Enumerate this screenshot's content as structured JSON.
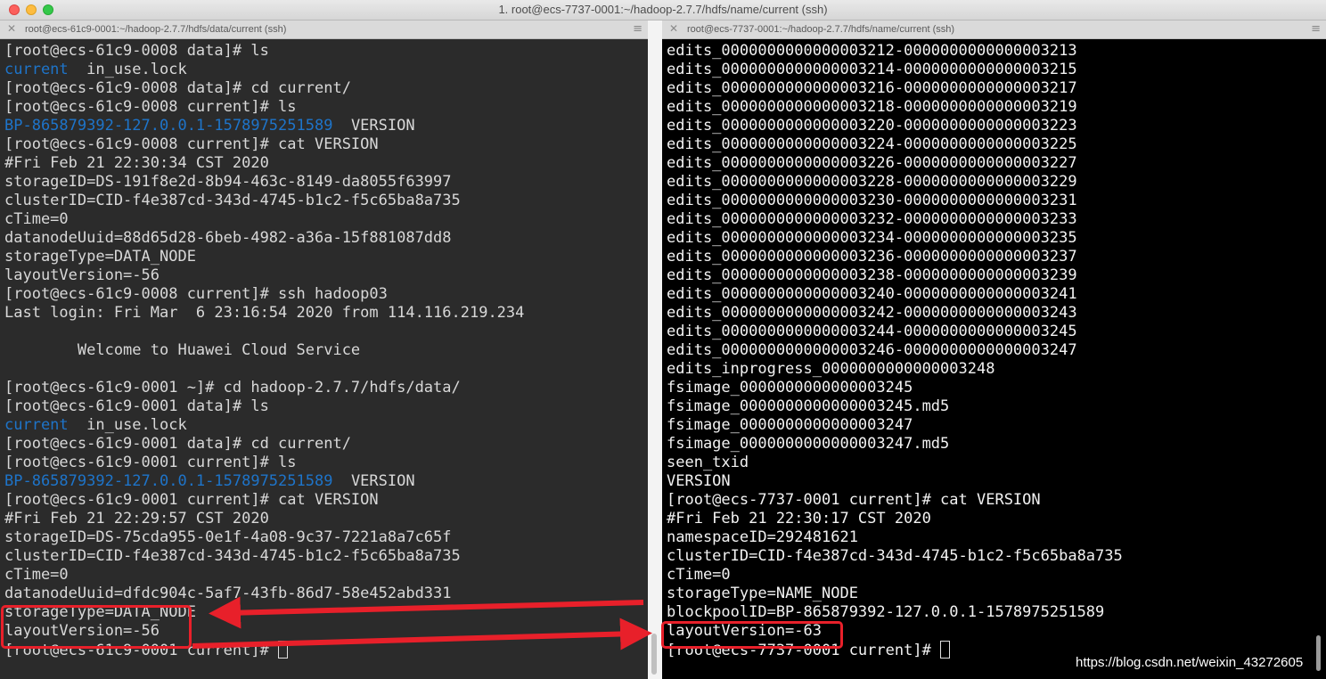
{
  "window": {
    "title": "1. root@ecs-7737-0001:~/hadoop-2.7.7/hdfs/name/current (ssh)"
  },
  "left_pane": {
    "tab_title": "root@ecs-61c9-0001:~/hadoop-2.7.7/hdfs/data/current (ssh)",
    "lines": [
      [
        {
          "t": "[root@ecs-61c9-0008 data]# ls"
        }
      ],
      [
        {
          "t": "current",
          "c": "blue"
        },
        {
          "t": "  in_use.lock"
        }
      ],
      [
        {
          "t": "[root@ecs-61c9-0008 data]# cd current/"
        }
      ],
      [
        {
          "t": "[root@ecs-61c9-0008 current]# ls"
        }
      ],
      [
        {
          "t": "BP-865879392-127.0.0.1-1578975251589",
          "c": "blue"
        },
        {
          "t": "  VERSION"
        }
      ],
      [
        {
          "t": "[root@ecs-61c9-0008 current]# cat VERSION"
        }
      ],
      [
        {
          "t": "#Fri Feb 21 22:30:34 CST 2020"
        }
      ],
      [
        {
          "t": "storageID=DS-191f8e2d-8b94-463c-8149-da8055f63997"
        }
      ],
      [
        {
          "t": "clusterID=CID-f4e387cd-343d-4745-b1c2-f5c65ba8a735"
        }
      ],
      [
        {
          "t": "cTime=0"
        }
      ],
      [
        {
          "t": "datanodeUuid=88d65d28-6beb-4982-a36a-15f881087dd8"
        }
      ],
      [
        {
          "t": "storageType=DATA_NODE"
        }
      ],
      [
        {
          "t": "layoutVersion=-56"
        }
      ],
      [
        {
          "t": "[root@ecs-61c9-0008 current]# ssh hadoop03"
        }
      ],
      [
        {
          "t": "Last login: Fri Mar  6 23:16:54 2020 from 114.116.219.234"
        }
      ],
      [
        {
          "t": ""
        }
      ],
      [
        {
          "t": "        Welcome to Huawei Cloud Service"
        }
      ],
      [
        {
          "t": ""
        }
      ],
      [
        {
          "t": "[root@ecs-61c9-0001 ~]# cd hadoop-2.7.7/hdfs/data/"
        }
      ],
      [
        {
          "t": "[root@ecs-61c9-0001 data]# ls"
        }
      ],
      [
        {
          "t": "current",
          "c": "blue"
        },
        {
          "t": "  in_use.lock"
        }
      ],
      [
        {
          "t": "[root@ecs-61c9-0001 data]# cd current/"
        }
      ],
      [
        {
          "t": "[root@ecs-61c9-0001 current]# ls"
        }
      ],
      [
        {
          "t": "BP-865879392-127.0.0.1-1578975251589",
          "c": "blue"
        },
        {
          "t": "  VERSION"
        }
      ],
      [
        {
          "t": "[root@ecs-61c9-0001 current]# cat VERSION"
        }
      ],
      [
        {
          "t": "#Fri Feb 21 22:29:57 CST 2020"
        }
      ],
      [
        {
          "t": "storageID=DS-75cda955-0e1f-4a08-9c37-7221a8a7c65f"
        }
      ],
      [
        {
          "t": "clusterID=CID-f4e387cd-343d-4745-b1c2-f5c65ba8a735"
        }
      ],
      [
        {
          "t": "cTime=0"
        }
      ],
      [
        {
          "t": "datanodeUuid=dfdc904c-5af7-43fb-86d7-58e452abd331"
        }
      ],
      [
        {
          "t": "storageType=DATA_NODE"
        }
      ],
      [
        {
          "t": "layoutVersion=-56"
        }
      ],
      [
        {
          "t": "[root@ecs-61c9-0001 current]# "
        },
        {
          "cursor": true
        }
      ]
    ]
  },
  "right_pane": {
    "tab_title": "root@ecs-7737-0001:~/hadoop-2.7.7/hdfs/name/current (ssh)",
    "lines": [
      [
        {
          "t": "edits_0000000000000003212-0000000000000003213"
        }
      ],
      [
        {
          "t": "edits_0000000000000003214-0000000000000003215"
        }
      ],
      [
        {
          "t": "edits_0000000000000003216-0000000000000003217"
        }
      ],
      [
        {
          "t": "edits_0000000000000003218-0000000000000003219"
        }
      ],
      [
        {
          "t": "edits_0000000000000003220-0000000000000003223"
        }
      ],
      [
        {
          "t": "edits_0000000000000003224-0000000000000003225"
        }
      ],
      [
        {
          "t": "edits_0000000000000003226-0000000000000003227"
        }
      ],
      [
        {
          "t": "edits_0000000000000003228-0000000000000003229"
        }
      ],
      [
        {
          "t": "edits_0000000000000003230-0000000000000003231"
        }
      ],
      [
        {
          "t": "edits_0000000000000003232-0000000000000003233"
        }
      ],
      [
        {
          "t": "edits_0000000000000003234-0000000000000003235"
        }
      ],
      [
        {
          "t": "edits_0000000000000003236-0000000000000003237"
        }
      ],
      [
        {
          "t": "edits_0000000000000003238-0000000000000003239"
        }
      ],
      [
        {
          "t": "edits_0000000000000003240-0000000000000003241"
        }
      ],
      [
        {
          "t": "edits_0000000000000003242-0000000000000003243"
        }
      ],
      [
        {
          "t": "edits_0000000000000003244-0000000000000003245"
        }
      ],
      [
        {
          "t": "edits_0000000000000003246-0000000000000003247"
        }
      ],
      [
        {
          "t": "edits_inprogress_0000000000000003248"
        }
      ],
      [
        {
          "t": "fsimage_0000000000000003245"
        }
      ],
      [
        {
          "t": "fsimage_0000000000000003245.md5"
        }
      ],
      [
        {
          "t": "fsimage_0000000000000003247"
        }
      ],
      [
        {
          "t": "fsimage_0000000000000003247.md5"
        }
      ],
      [
        {
          "t": "seen_txid"
        }
      ],
      [
        {
          "t": "VERSION"
        }
      ],
      [
        {
          "t": "[root@ecs-7737-0001 current]# cat VERSION"
        }
      ],
      [
        {
          "t": "#Fri Feb 21 22:30:17 CST 2020"
        }
      ],
      [
        {
          "t": "namespaceID=292481621"
        }
      ],
      [
        {
          "t": "clusterID=CID-f4e387cd-343d-4745-b1c2-f5c65ba8a735"
        }
      ],
      [
        {
          "t": "cTime=0"
        }
      ],
      [
        {
          "t": "storageType=NAME_NODE"
        }
      ],
      [
        {
          "t": "blockpoolID=BP-865879392-127.0.0.1-1578975251589"
        }
      ],
      [
        {
          "t": "layoutVersion=-63"
        }
      ],
      [
        {
          "t": "[root@ecs-7737-0001 current]# "
        },
        {
          "cursor": true
        }
      ]
    ]
  },
  "watermark": "https://blog.csdn.net/weixin_43272605",
  "colors": {
    "annotation_red": "#e8202a",
    "dir_blue": "#1e74c9"
  }
}
